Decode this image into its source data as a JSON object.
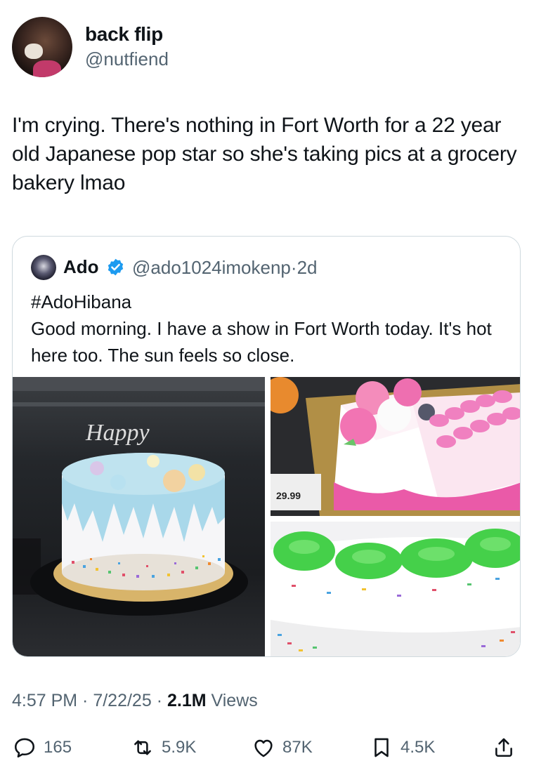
{
  "tweet": {
    "author_name": "back flip",
    "author_handle": "@nutfiend",
    "text": "I'm crying. There's nothing in Fort Worth for a 22 year old Japanese pop star so she's taking pics at a grocery bakery lmao",
    "time": "4:57 PM",
    "date": "7/22/25",
    "views_count": "2.1M",
    "views_label": "Views"
  },
  "quote": {
    "author_name": "Ado",
    "author_handle": "@ado1024imokenp",
    "age": "2d",
    "hashtag": "#AdoHibana",
    "text": "Good morning. I have a show in Fort Worth today. It's hot here too. The sun feels so close.",
    "photos": [
      {
        "topper_text": "Happy"
      },
      {
        "price_tag": "29.99"
      },
      {}
    ]
  },
  "actions": {
    "replies": "165",
    "reposts": "5.9K",
    "likes": "87K",
    "bookmarks": "4.5K"
  },
  "icons": [
    "verified-badge-icon",
    "reply-icon",
    "repost-icon",
    "like-icon",
    "bookmark-icon",
    "share-icon"
  ],
  "colors": {
    "text_primary": "#0f1419",
    "text_secondary": "#536471",
    "border": "#cfd9de",
    "verified_blue": "#1d9bf0"
  }
}
